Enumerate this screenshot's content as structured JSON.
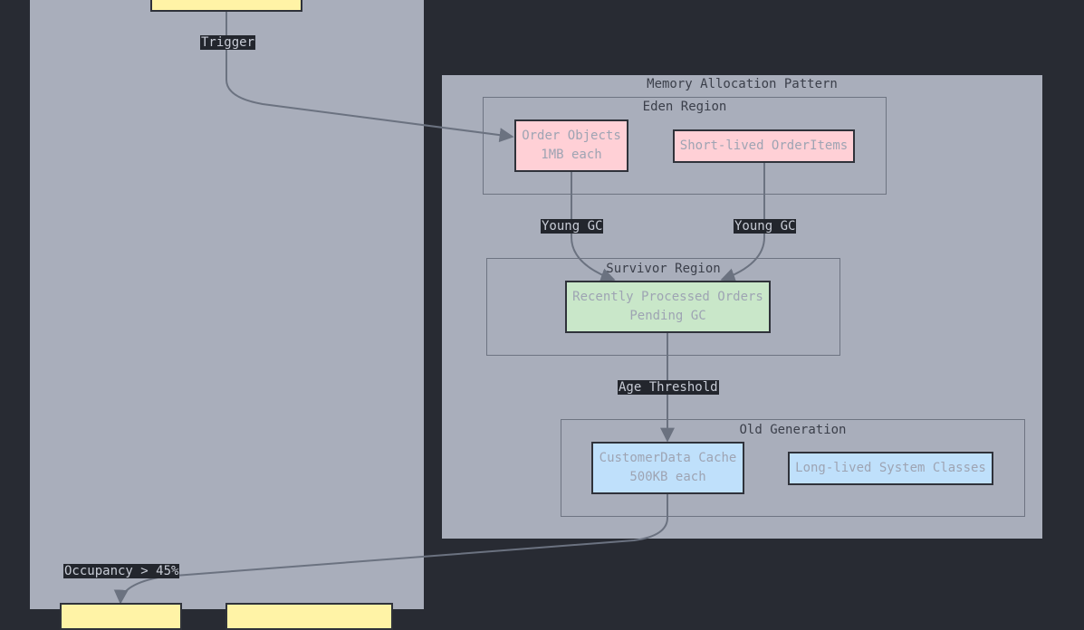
{
  "colors": {
    "background": "#282b33",
    "panel": "#a9aebb",
    "edge": "#6b7280",
    "eden_node": "#ffd0d6",
    "survivor_node": "#c9e7c9",
    "old_node": "#bfe0fb",
    "trigger_node": "#fff3a6"
  },
  "clusters": {
    "memory_allocation": "Memory Allocation Pattern",
    "eden": "Eden Region",
    "survivor": "Survivor Region",
    "old": "Old Generation"
  },
  "nodes": {
    "order_objects": "Order Objects\n1MB each",
    "short_lived_items": "Short-lived OrderItems",
    "recently_processed": "Recently Processed Orders\nPending GC",
    "customer_cache": "CustomerData Cache\n500KB each",
    "system_classes": "Long-lived System Classes"
  },
  "edge_labels": {
    "trigger": "Trigger",
    "young_gc_1": "Young GC",
    "young_gc_2": "Young GC",
    "age_threshold": "Age Threshold",
    "occupancy": "Occupancy > 45%"
  }
}
